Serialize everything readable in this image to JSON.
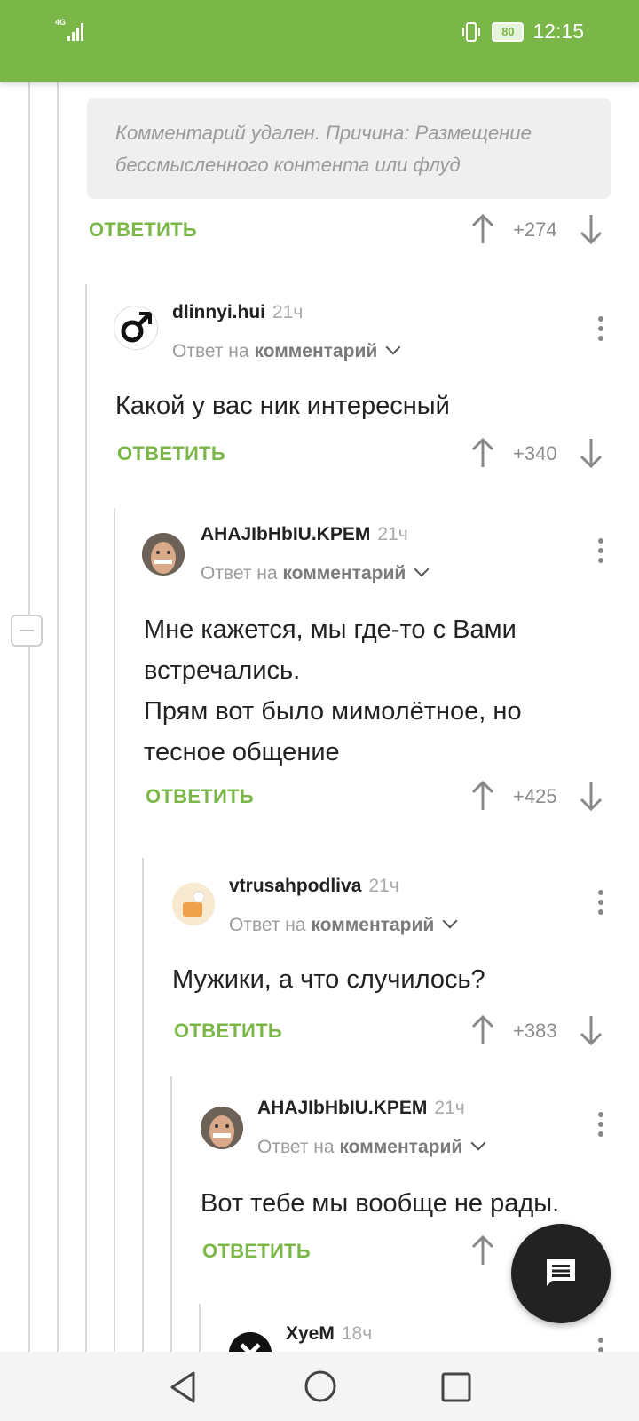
{
  "status_bar": {
    "network": "4G",
    "battery": "80",
    "time": "12:15"
  },
  "deleted_comment": {
    "text": "Комментарий удален. Причина: Размещение бессмысленного контента или флуд",
    "reply_label": "ОТВЕТИТЬ",
    "score": "+274"
  },
  "comments": [
    {
      "username": "dlinnyi.hui",
      "time": "21ч",
      "reply_prefix": "Ответ на",
      "reply_target": "комментарий",
      "text": "Какой у вас ник интересный",
      "reply_label": "ОТВЕТИТЬ",
      "score": "+340"
    },
    {
      "username": "AHAJIbHbIU.KPEM",
      "time": "21ч",
      "reply_prefix": "Ответ на",
      "reply_target": "комментарий",
      "text_line1": "Мне кажется, мы где-то с Вами встречались.",
      "text_line2": "Прям вот было мимолётное, но тесное общение",
      "reply_label": "ОТВЕТИТЬ",
      "score": "+425"
    },
    {
      "username": "vtrusahpodliva",
      "time": "21ч",
      "reply_prefix": "Ответ на",
      "reply_target": "комментарий",
      "text": "Мужики, а что случилось?",
      "reply_label": "ОТВЕТИТЬ",
      "score": "+383"
    },
    {
      "username": "AHAJIbHbIU.KPEM",
      "time": "21ч",
      "reply_prefix": "Ответ на",
      "reply_target": "комментарий",
      "text": "Вот тебе мы вообще не рады.",
      "reply_label": "ОТВЕТИТЬ"
    },
    {
      "username": "XyeM",
      "time": "18ч"
    }
  ],
  "colors": {
    "accent": "#7ab648",
    "fab": "#222222"
  }
}
